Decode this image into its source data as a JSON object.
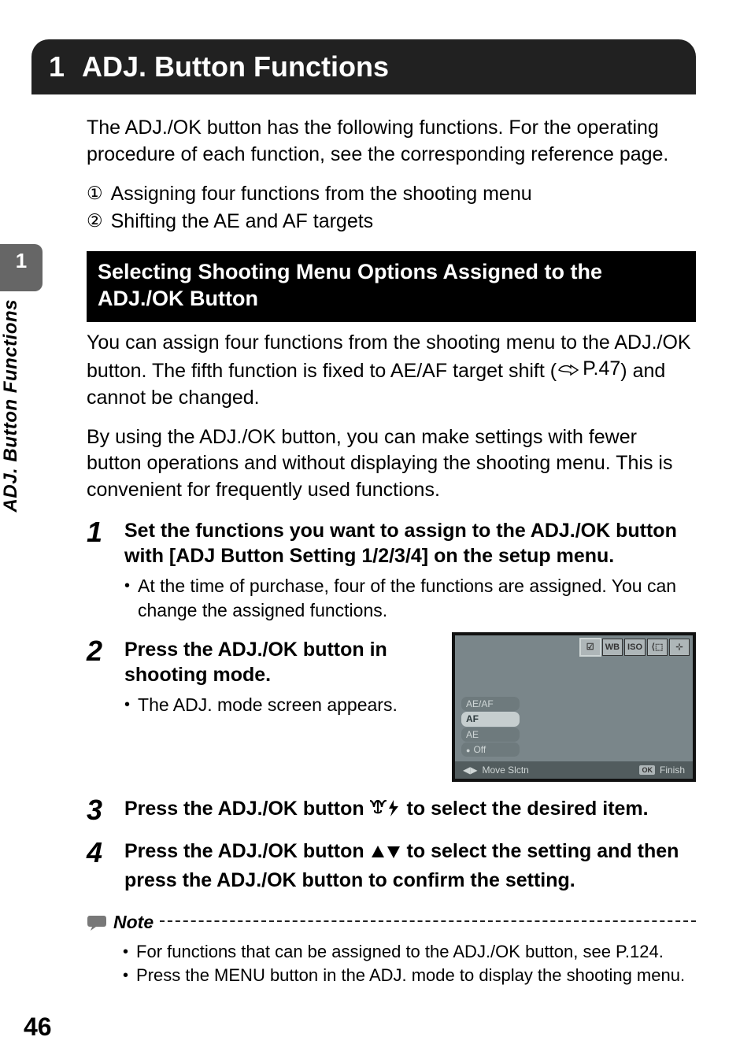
{
  "chapter": {
    "number": "1",
    "title": "ADJ. Button Functions"
  },
  "sidebar": {
    "section_number": "1",
    "section_label": "ADJ. Button Functions"
  },
  "intro": "The ADJ./OK button has the following functions. For the operating procedure of each function, see the corresponding reference page.",
  "circled": [
    "Assigning four functions from the shooting menu",
    "Shifting the AE and AF targets"
  ],
  "subheading": "Selecting Shooting Menu Options Assigned to the ADJ./OK Button",
  "para1_a": "You can assign four functions from the shooting menu to the ADJ./OK button. The fifth function is fixed to AE/AF target shift (",
  "para1_ref": "P.47",
  "para1_b": ") and cannot be changed.",
  "para2": "By using the ADJ./OK button, you can make settings with fewer button operations and without displaying the shooting menu. This is convenient for frequently used functions.",
  "steps": {
    "s1": {
      "title": "Set the functions you want to assign to the ADJ./OK button with [ADJ Button Setting 1/2/3/4] on the setup menu.",
      "bullet": "At the time of purchase, four of the functions are assigned. You can change the assigned functions."
    },
    "s2": {
      "title": "Press the ADJ./OK button in shooting mode.",
      "bullet": "The ADJ. mode screen appears."
    },
    "s3": {
      "prefix": "Press the ADJ./OK button ",
      "suffix": " to select the desired item."
    },
    "s4": {
      "prefix": "Press the ADJ./OK button ",
      "suffix": " to select the setting and then press the ADJ./OK button to confirm the setting."
    }
  },
  "lcd": {
    "chips": {
      "ev": "☑",
      "wb": "WB",
      "iso": "ISO",
      "af": "⟨⬚",
      "cross": "⊹"
    },
    "menu": [
      "AE/AF",
      "AF",
      "AE",
      "Off"
    ],
    "bottom_left_arrows": "◀▶",
    "bottom_left": "Move Slctn",
    "bottom_ok": "OK",
    "bottom_right": "Finish"
  },
  "note": {
    "label": "Note",
    "bullets": [
      "For functions that can be assigned to the ADJ./OK button, see P.124.",
      "Press the MENU button in the ADJ. mode to display the shooting menu."
    ]
  },
  "page_number": "46"
}
